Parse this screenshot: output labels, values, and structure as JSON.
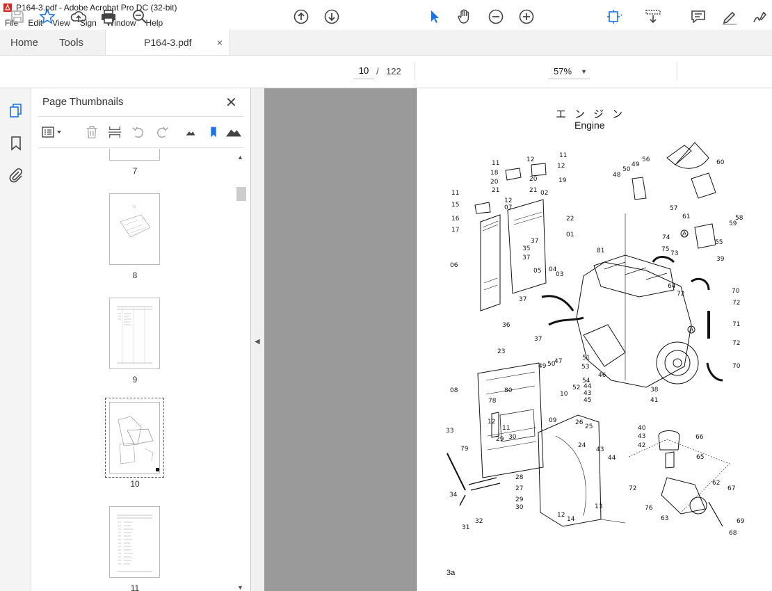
{
  "window": {
    "title": "P164-3.pdf - Adobe Acrobat Pro DC (32-bit)"
  },
  "menu": [
    "File",
    "Edit",
    "View",
    "Sign",
    "Window",
    "Help"
  ],
  "tabs": {
    "home": "Home",
    "tools": "Tools",
    "document": "P164-3.pdf",
    "close_glyph": "×"
  },
  "toolbar": {
    "current_page": "10",
    "page_separator": "/",
    "total_pages": "122",
    "zoom": "57%"
  },
  "panel": {
    "title": "Page Thumbnails",
    "close_glyph": "✕",
    "thumbnails": [
      {
        "page": "7"
      },
      {
        "page": "8"
      },
      {
        "page": "9"
      },
      {
        "page": "10",
        "selected": true
      },
      {
        "page": "11"
      }
    ]
  },
  "document": {
    "title_jp": "エンジン",
    "title_en": "Engine",
    "page_label": "3a",
    "callouts": [
      "11",
      "12",
      "11",
      "12",
      "18",
      "20",
      "19",
      "20",
      "21",
      "02",
      "21",
      "11",
      "12",
      "15",
      "07",
      "16",
      "22",
      "17",
      "01",
      "37",
      "35",
      "06",
      "37",
      "05",
      "04",
      "03",
      "37",
      "36",
      "37",
      "23",
      "49",
      "50",
      "47",
      "51",
      "53",
      "08",
      "78",
      "80",
      "10",
      "12",
      "11",
      "09",
      "29",
      "30",
      "33",
      "79",
      "26",
      "25",
      "24",
      "34",
      "28",
      "27",
      "29",
      "30",
      "31",
      "32",
      "12",
      "14",
      "13",
      "48",
      "50",
      "49",
      "56",
      "60",
      "57",
      "61",
      "58",
      "59",
      "55",
      "39",
      "74",
      "75",
      "73",
      "81",
      "64",
      "72",
      "70",
      "72",
      "71",
      "72",
      "70",
      "38",
      "46",
      "54",
      "44",
      "43",
      "45",
      "52",
      "41",
      "40",
      "43",
      "42",
      "44",
      "43",
      "66",
      "65",
      "72",
      "62",
      "67",
      "76",
      "63",
      "69",
      "68",
      "A",
      "A"
    ]
  },
  "colors": {
    "accent": "#1a73e8",
    "doc_background": "#9a9a9a",
    "tab_bar": "#f2f2f2"
  }
}
